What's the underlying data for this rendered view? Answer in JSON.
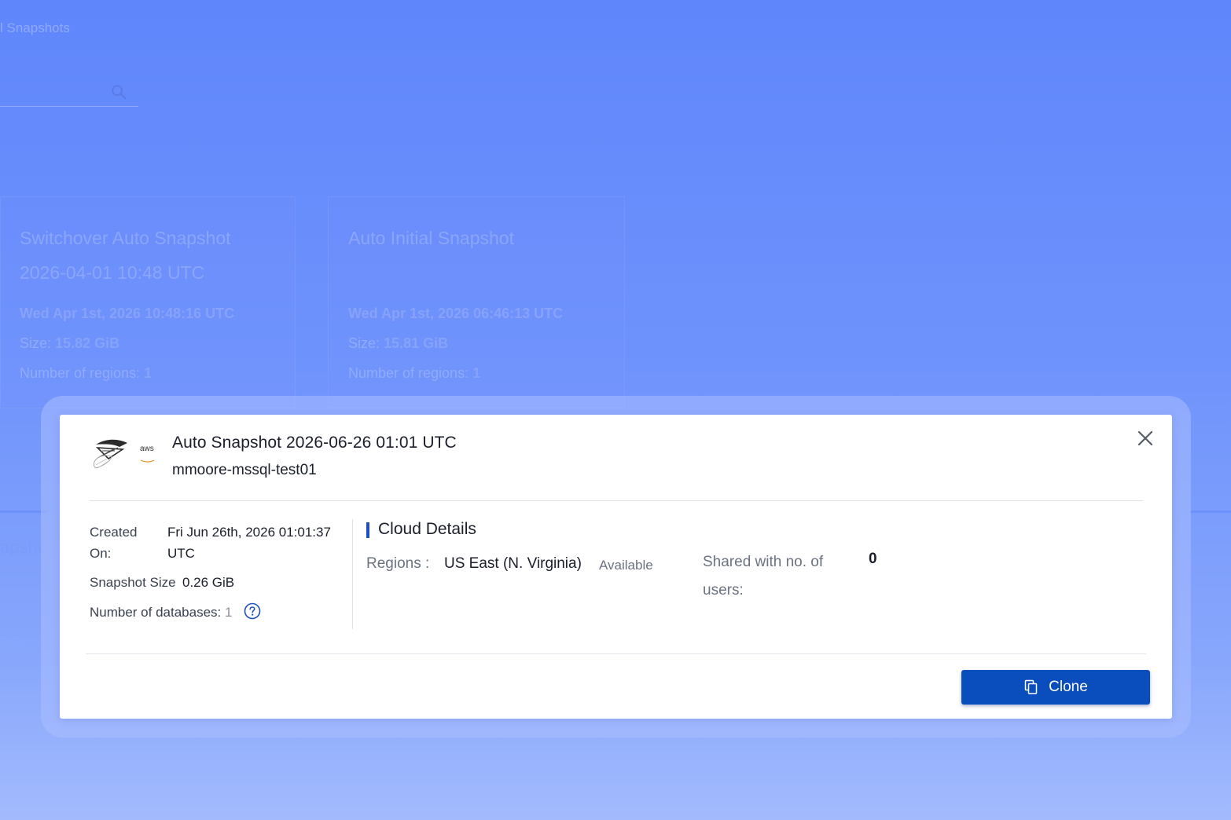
{
  "background": {
    "breadcrumb": "l Snapshots",
    "cards": [
      {
        "title": "Switchover Auto Snapshot 2026-04-01 10:48 UTC",
        "date": "Wed Apr 1st, 2026 10:48:16 UTC",
        "size_label": "Size:",
        "size_value": "15.82 GiB",
        "regions_label": "Number of regions:",
        "regions_value": "1"
      },
      {
        "title": "Auto Initial Snapshot",
        "date": "Wed Apr 1st, 2026 06:46:13 UTC",
        "size_label": "Size:",
        "size_value": "15.81 GiB",
        "regions_label": "Number of regions:",
        "regions_value": "1"
      }
    ],
    "fragment_1": "apsho",
    "fragment_2": "TC"
  },
  "modal": {
    "db_icon": "sql-server-icon",
    "cloud_icon": "aws-icon",
    "cloud_label": "aws",
    "title": "Auto Snapshot 2026-06-26 01:01 UTC",
    "subtitle": "mmoore-mssql-test01",
    "created_label": "Created On:",
    "created_value": "Fri Jun 26th, 2026 01:01:37 UTC",
    "snapshot_size_label": "Snapshot Size",
    "snapshot_size_value": "0.26 GiB",
    "num_databases_label": "Number of databases:",
    "num_databases_value": "1",
    "cloud_details_title": "Cloud Details",
    "regions_label": "Regions :",
    "regions_value": "US East (N. Virginia)",
    "regions_status": "Available",
    "shared_label": "Shared with no. of users:",
    "shared_value": "0",
    "clone_label": "Clone"
  },
  "colors": {
    "primary": "#0a4dbd",
    "section_accent": "#1d4fbf",
    "overlay": "#5f86fb"
  }
}
